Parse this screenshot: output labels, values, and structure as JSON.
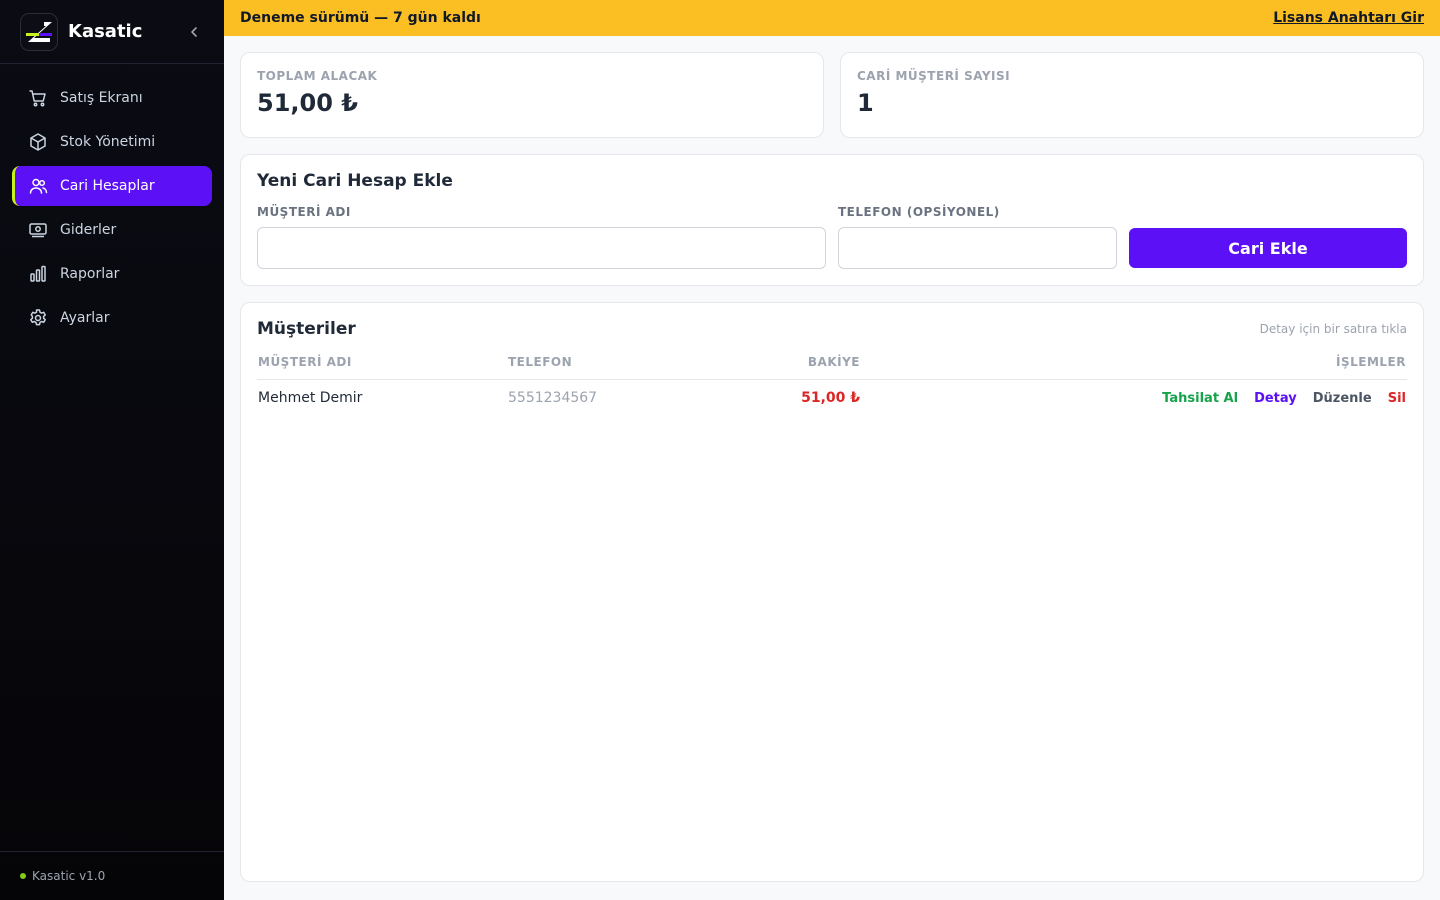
{
  "app": {
    "name": "Kasatic",
    "version": "Kasatic v1.0"
  },
  "sidebar": {
    "items": [
      {
        "label": "Satış Ekranı",
        "icon": "cart-icon"
      },
      {
        "label": "Stok Yönetimi",
        "icon": "box-icon"
      },
      {
        "label": "Cari Hesaplar",
        "icon": "users-icon",
        "active": true
      },
      {
        "label": "Giderler",
        "icon": "cash-icon"
      },
      {
        "label": "Raporlar",
        "icon": "bar-chart-icon"
      },
      {
        "label": "Ayarlar",
        "icon": "gear-icon"
      }
    ]
  },
  "banner": {
    "text": "Deneme sürümü — 7 gün kaldı",
    "link": "Lisans Anahtarı Gir"
  },
  "stats": {
    "total_receivable": {
      "label": "TOPLAM ALACAK",
      "value": "51,00 ₺"
    },
    "customer_count": {
      "label": "CARİ MÜŞTERİ SAYISI",
      "value": "1"
    }
  },
  "new_account": {
    "title": "Yeni Cari Hesap Ekle",
    "name_label": "MÜŞTERİ ADI",
    "name_value": "",
    "phone_label": "TELEFON (OPSİYONEL)",
    "phone_value": "",
    "submit_label": "Cari Ekle"
  },
  "customers": {
    "title": "Müşteriler",
    "hint": "Detay için bir satıra tıkla",
    "columns": [
      "MÜŞTERİ ADI",
      "TELEFON",
      "BAKİYE",
      "İŞLEMLER"
    ],
    "rows": [
      {
        "name": "Mehmet Demir",
        "phone": "5551234567",
        "balance": "51,00 ₺"
      }
    ],
    "actions": {
      "collect": "Tahsilat Al",
      "detail": "Detay",
      "edit": "Düzenle",
      "delete": "Sil"
    }
  },
  "colors": {
    "accent": "#5b10f5",
    "highlight": "#c6f31f",
    "banner": "#fbbf24",
    "negative": "#dc2626",
    "positive": "#16a34a"
  }
}
